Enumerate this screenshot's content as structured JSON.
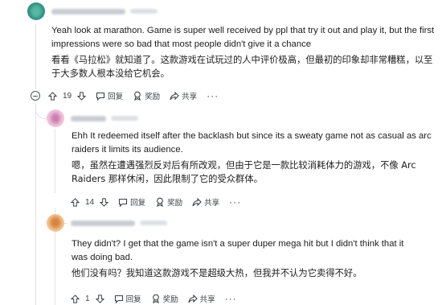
{
  "comments": [
    {
      "text_en": "Yeah look at marathon. Game is super well received by ppl that try it out and play it, but the first impressions were so bad that most people didn't give it a chance",
      "text_zh": "看看《马拉松》就知道了。这款游戏在试玩过的人中评价极高，但最初的印象却非常糟糕，以至于大多数人根本没给它机会。",
      "votes": "19",
      "reply_label": "回复",
      "award_label": "奖励",
      "share_label": "共享",
      "more_label": "···"
    },
    {
      "text_en": "Ehh It redeemed itself after the backlash but since its a sweaty game not as casual as arc raiders it limits its audience.",
      "text_zh": "嗯，虽然在遭遇强烈反对后有所改观，但由于它是一款比较消耗体力的游戏，不像 Arc Raiders 那样休闲，因此限制了它的受众群体。",
      "votes": "14",
      "reply_label": "回复",
      "award_label": "奖励",
      "share_label": "共享",
      "more_label": "···"
    },
    {
      "text_en": "They didn't? I get that the game isn't a super duper mega hit but I didn't think that it was doing bad.",
      "text_zh": "他们没有吗？我知道这款游戏不是超级大热，但我并不认为它卖得不好。",
      "votes": "1",
      "reply_label": "回复",
      "award_label": "奖励",
      "share_label": "共享",
      "more_label": "···"
    }
  ],
  "colors": {
    "avatar1": "#2f8f7f",
    "avatar2": "#e7a4c9",
    "avatar3": "#e9a36a",
    "thread": "#dfe3e7"
  }
}
